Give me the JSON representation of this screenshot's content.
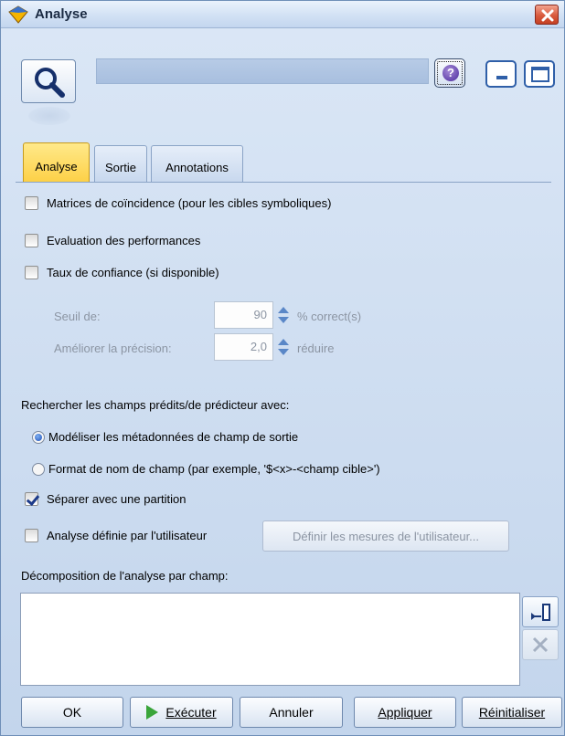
{
  "window": {
    "title": "Analyse",
    "icons": {
      "app": "diamond-node-icon",
      "node": "magnifier-icon",
      "help": "help-icon",
      "close": "close-icon"
    }
  },
  "tabs": [
    {
      "label": "Analyse",
      "active": true
    },
    {
      "label": "Sortie",
      "active": false
    },
    {
      "label": "Annotations",
      "active": false
    }
  ],
  "options": {
    "coincidence_label": "Matrices de coïncidence (pour les cibles symboliques)",
    "coincidence_checked": false,
    "performance_label": "Evaluation des performances",
    "performance_checked": false,
    "confidence_label": "Taux de confiance (si disponible)",
    "confidence_checked": false,
    "threshold_label": "Seuil de:",
    "threshold_value": "90",
    "threshold_unit": "% correct(s)",
    "precision_label": "Améliorer la précision:",
    "precision_value": "2,0",
    "precision_unit": "réduire"
  },
  "search": {
    "heading": "Rechercher les champs prédits/de prédicteur avec:",
    "radio1_label": "Modéliser les métadonnées de champ de sortie",
    "radio1_selected": true,
    "radio2_label": "Format de nom de champ (par exemple, '$<x>-<champ cible>')",
    "radio2_selected": false
  },
  "partition": {
    "label": "Séparer avec une partition",
    "checked": true
  },
  "user_analysis": {
    "label": "Analyse définie par l'utilisateur",
    "checked": false,
    "button_label": "Définir les mesures de l'utilisateur..."
  },
  "breakdown": {
    "label": "Décomposition de l'analyse par champ:",
    "items": [],
    "icons": {
      "pick": "field-picker-icon",
      "delete": "delete-x-icon"
    }
  },
  "buttons": {
    "ok": "OK",
    "execute": "Exécuter",
    "cancel": "Annuler",
    "apply": "Appliquer",
    "reset": "Réinitialiser"
  },
  "colors": {
    "active_tab": "#fdd046",
    "accent": "#2f5fa8",
    "run_green": "#3aa53a"
  }
}
